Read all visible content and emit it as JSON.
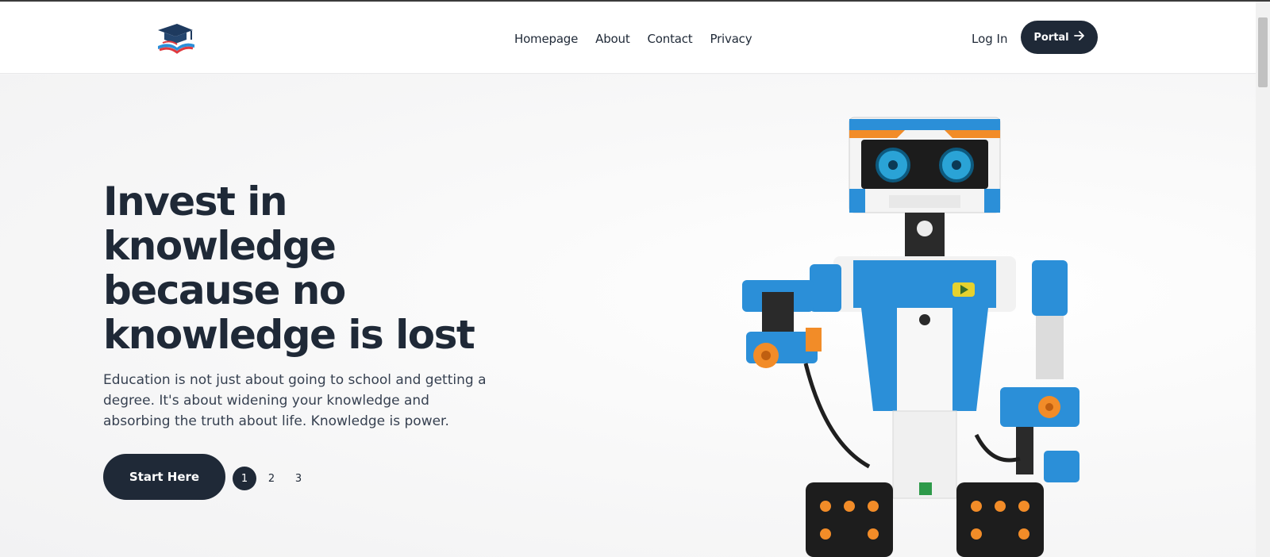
{
  "header": {
    "nav": [
      "Homepage",
      "About",
      "Contact",
      "Privacy"
    ],
    "login_label": "Log In",
    "portal_label": "Portal"
  },
  "hero": {
    "title": "Invest in knowledge because no knowledge is lost",
    "title_lines": [
      "Invest in",
      "knowledge",
      "because no",
      "knowledge is lost"
    ],
    "subtitle": "Education is not just about going to school and getting a degree. It's about widening your knowledge and absorbing the truth about life. Knowledge is power.",
    "cta_label": "Start Here",
    "pages": [
      "1",
      "2",
      "3"
    ],
    "active_page": "1"
  },
  "colors": {
    "primary": "#1f2937",
    "robot_blue": "#2b8fd8",
    "robot_orange": "#f28c28"
  },
  "icons": {
    "logo": "graduation-cap-book-icon",
    "portal": "arrow-right-icon"
  }
}
